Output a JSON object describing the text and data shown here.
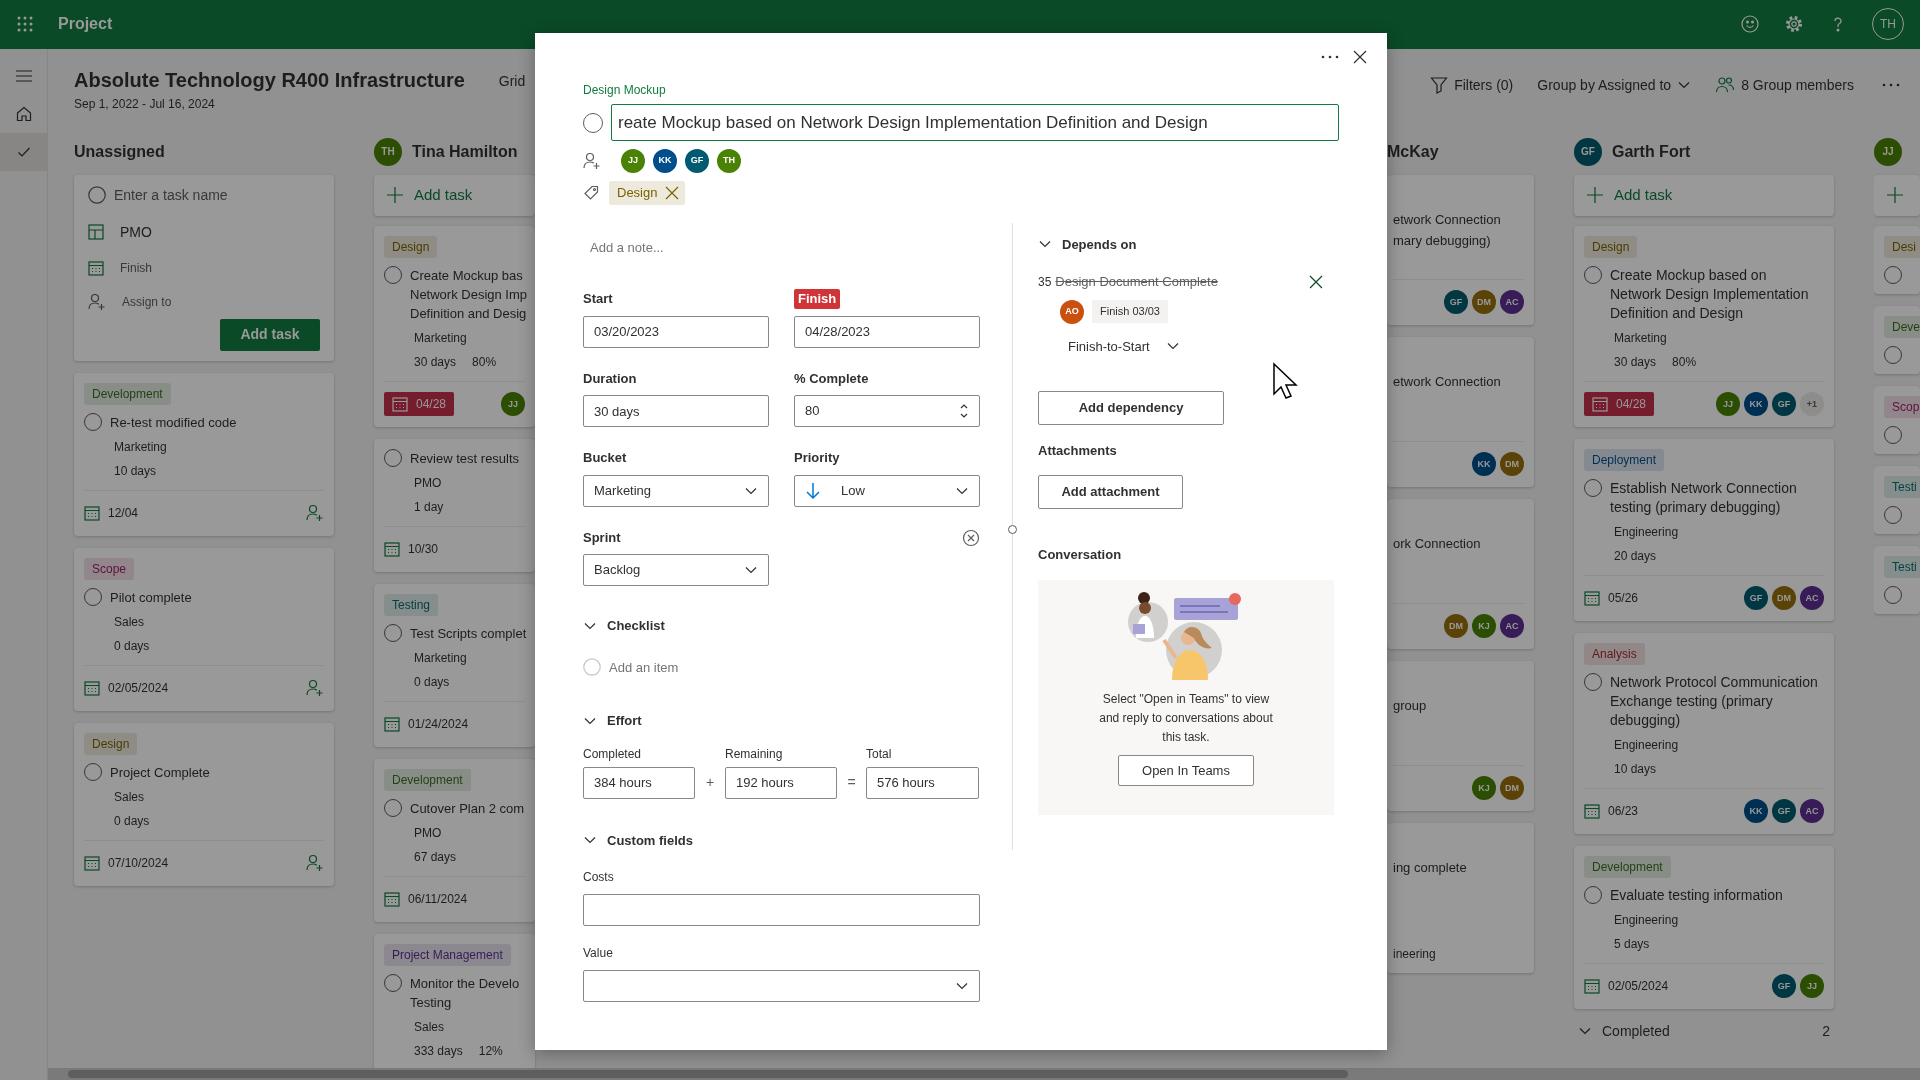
{
  "app": {
    "name": "Project",
    "user": "TH"
  },
  "nav": {
    "items": [
      {
        "selected": false
      },
      {
        "selected": true
      }
    ]
  },
  "plan": {
    "title": "Absolute Technology R400 Infrastructure",
    "dates": "Sep 1, 2022 - Jul 16, 2024",
    "view": "Grid",
    "filters": "Filters (0)",
    "group_by": "Group by Assigned to",
    "members": "8 Group members"
  },
  "columns": [
    {
      "kind": "unassigned",
      "name": "Unassigned",
      "new_task": {
        "placeholder": "Enter a task name",
        "bucket": "PMO",
        "finish": "Finish",
        "assign": "Assign to",
        "button": "Add task"
      },
      "cards": [
        {
          "tag": {
            "label": "Development",
            "color": "#234213"
          },
          "title_lines": [
            "Re-test modified code"
          ],
          "completed": false,
          "bucket": "Marketing",
          "duration": "10 days",
          "date": "12/04",
          "overdue": false,
          "assign": true
        },
        {
          "tag": {
            "label": "Scope",
            "color": "#5d113b"
          },
          "title_lines": [
            "Pilot complete"
          ],
          "completed": false,
          "bucket": "Sales",
          "duration": "0 days",
          "date": "02/05/2024",
          "overdue": false,
          "assign": true
        },
        {
          "tag": {
            "label": "Design",
            "color": "#493c00"
          },
          "title_lines": [
            "Project Complete"
          ],
          "completed": false,
          "bucket": "Sales",
          "duration": "0 days",
          "date": "07/10/2024",
          "overdue": false,
          "assign": true
        }
      ]
    },
    {
      "kind": "cut",
      "name": "Tina Hamilton",
      "initials": "TH",
      "color": "#2c4e03",
      "add_task": "Add task",
      "cards": [
        {
          "tag": {
            "label": "Design",
            "color": "#493c00"
          },
          "title_lines": [
            "Create Mockup bas",
            "Network Design Imp",
            "Definition and Desig"
          ],
          "completed": false,
          "bucket": "Marketing",
          "duration": "30 days",
          "progress": "80%",
          "date": "04/28",
          "overdue": true,
          "avatars": [
            {
              "initials": "JJ",
              "color": "#2c4e03"
            }
          ]
        },
        {
          "title_lines": [
            "Review test results"
          ],
          "completed": false,
          "bucket": "PMO",
          "duration": "1 day",
          "date": "10/30",
          "overdue": false
        },
        {
          "tag": {
            "label": "Testing",
            "color": "#074040"
          },
          "title_lines": [
            "Test Scripts complet"
          ],
          "completed": false,
          "bucket": "Marketing",
          "duration": "0 days",
          "date": "01/24/2024",
          "overdue": false
        },
        {
          "tag": {
            "label": "Development",
            "color": "#234213"
          },
          "title_lines": [
            "Cutover Plan 2 com"
          ],
          "completed": false,
          "bucket": "PMO",
          "duration": "67 days",
          "date": "06/11/2024",
          "overdue": false
        },
        {
          "tag": {
            "label": "Project Management",
            "color": "#371c57"
          },
          "title_lines": [
            "Monitor the Develo",
            "Testing"
          ],
          "completed": false,
          "bucket": "Sales",
          "duration": "333 days",
          "progress": "12%"
        }
      ]
    },
    {
      "kind": "partial",
      "name": "McKay",
      "cards": [
        {
          "title_lines": [
            "etwork Connection",
            "mary debugging)"
          ],
          "avatars": [
            {
              "initials": "GF",
              "color": "#003743"
            },
            {
              "initials": "DM",
              "color": "#5b4307"
            },
            {
              "initials": "AC",
              "color": "#371c57"
            }
          ]
        },
        {
          "title_lines": [
            "etwork Connection"
          ],
          "avatars": [
            {
              "initials": "KK",
              "color": "#002f54"
            },
            {
              "initials": "DM",
              "color": "#5b4307"
            }
          ]
        },
        {
          "title_lines": [
            "ork Connection"
          ],
          "avatars": [
            {
              "initials": "DM",
              "color": "#5b4307"
            },
            {
              "initials": "KJ",
              "color": "#2c4e03"
            },
            {
              "initials": "AC",
              "color": "#371c57"
            }
          ]
        },
        {
          "title_lines": [
            "group"
          ],
          "avatars": [
            {
              "initials": "KJ",
              "color": "#2c4e03"
            },
            {
              "initials": "DM",
              "color": "#5b4307"
            }
          ]
        },
        {
          "title_lines": [
            "ing complete"
          ],
          "bucket": "ineering"
        }
      ]
    },
    {
      "kind": "member",
      "name": "Garth Fort",
      "initials": "GF",
      "color": "#003743",
      "add_task": "Add task",
      "cards": [
        {
          "tag": {
            "label": "Design",
            "color": "#493c00"
          },
          "title_lines": [
            "Create Mockup based on Network Design Implementation Definition and Design"
          ],
          "completed": false,
          "bucket": "Marketing",
          "duration": "30 days",
          "progress": "80%",
          "date": "04/28",
          "overdue": true,
          "avatars": [
            {
              "initials": "JJ",
              "color": "#2c4e03"
            },
            {
              "initials": "KK",
              "color": "#002f54"
            },
            {
              "initials": "GF",
              "color": "#003743"
            }
          ],
          "more": "+1"
        },
        {
          "tag": {
            "label": "Deployment",
            "color": "#002f54"
          },
          "title_lines": [
            "Establish Network Connection testing (primary debugging)"
          ],
          "completed": false,
          "bucket": "Engineering",
          "duration": "20 days",
          "date": "05/26",
          "overdue": false,
          "avatars": [
            {
              "initials": "GF",
              "color": "#003743"
            },
            {
              "initials": "DM",
              "color": "#5b4307"
            },
            {
              "initials": "AC",
              "color": "#371c57"
            }
          ]
        },
        {
          "tag": {
            "label": "Analysis",
            "color": "#62171a"
          },
          "title_lines": [
            "Network Protocol Communication Exchange testing (primary debugging)"
          ],
          "completed": false,
          "bucket": "Engineering",
          "duration": "10 days",
          "date": "06/23",
          "overdue": false,
          "avatars": [
            {
              "initials": "KK",
              "color": "#002f54"
            },
            {
              "initials": "GF",
              "color": "#003743"
            },
            {
              "initials": "AC",
              "color": "#371c57"
            }
          ]
        },
        {
          "tag": {
            "label": "Development",
            "color": "#234213"
          },
          "title_lines": [
            "Evaluate testing information"
          ],
          "completed": false,
          "bucket": "Engineering",
          "duration": "5 days",
          "date": "02/05/2024",
          "overdue": false,
          "avatars": [
            {
              "initials": "GF",
              "color": "#003743"
            },
            {
              "initials": "JJ",
              "color": "#2c4e03"
            }
          ]
        }
      ],
      "completed": {
        "label": "Completed",
        "count": "2"
      }
    },
    {
      "kind": "edge",
      "initials": "JJ",
      "color": "#2c4e03",
      "cards": [
        {
          "tag": {
            "label": "Desi",
            "color": "#493c00"
          },
          "completed": false
        },
        {
          "tag": {
            "label": "Deve",
            "color": "#234213"
          },
          "completed": false
        },
        {
          "tag": {
            "label": "Scop",
            "color": "#5d113b"
          },
          "completed": false
        },
        {
          "tag": {
            "label": "Testi",
            "color": "#074040"
          },
          "completed": false
        },
        {
          "tag": {
            "label": "Testi",
            "color": "#074040"
          },
          "completed": false
        }
      ]
    }
  ],
  "task": {
    "bucket_link": "Design Mockup",
    "title": "reate Mockup based on Network Design Implementation Definition and Design",
    "completed": false,
    "assignees": [
      {
        "initials": "JJ",
        "color": "#498205"
      },
      {
        "initials": "KK",
        "color": "#004e8c"
      },
      {
        "initials": "GF",
        "color": "#005b70"
      },
      {
        "initials": "TH",
        "color": "#498205"
      }
    ],
    "labels": [
      {
        "label": "Design",
        "color": "#7a6400"
      }
    ],
    "note_placeholder": "Add a note...",
    "start": {
      "label": "Start",
      "value": "03/20/2023"
    },
    "finish": {
      "label": "Finish",
      "value": "04/28/2023",
      "overdue": true
    },
    "duration": {
      "label": "Duration",
      "value": "30 days"
    },
    "percent": {
      "label": "% Complete",
      "value": "80"
    },
    "bucket": {
      "label": "Bucket",
      "value": "Marketing"
    },
    "priority": {
      "label": "Priority",
      "value": "Low"
    },
    "sprint": {
      "label": "Sprint",
      "value": "Backlog"
    },
    "checklist": {
      "title": "Checklist",
      "expanded": true,
      "placeholder": "Add an item"
    },
    "effort": {
      "title": "Effort",
      "expanded": true,
      "completed": {
        "label": "Completed",
        "value": "384 hours"
      },
      "plus": "+",
      "remaining": {
        "label": "Remaining",
        "value": "192 hours"
      },
      "equals": "=",
      "total": {
        "label": "Total",
        "value": "576 hours"
      }
    },
    "custom": {
      "title": "Custom fields",
      "expanded": true,
      "fields": [
        {
          "label": "Costs",
          "kind": "text"
        },
        {
          "label": "Value",
          "kind": "select"
        }
      ]
    },
    "depends": {
      "title": "Depends on",
      "expanded": true,
      "items": [
        {
          "id": "35",
          "title": "Design Document Complete",
          "completed": true,
          "assignee": {
            "initials": "AO",
            "color": "#ca5010"
          },
          "finish": "Finish 03/03",
          "type": "Finish-to-Start"
        }
      ],
      "add": "Add dependency"
    },
    "attachments": {
      "title": "Attachments",
      "add": "Add attachment"
    },
    "conversation": {
      "title": "Conversation",
      "text": "Select \"Open in Teams\" to view and reply to conversations about this task.",
      "button": "Open In Teams"
    }
  }
}
